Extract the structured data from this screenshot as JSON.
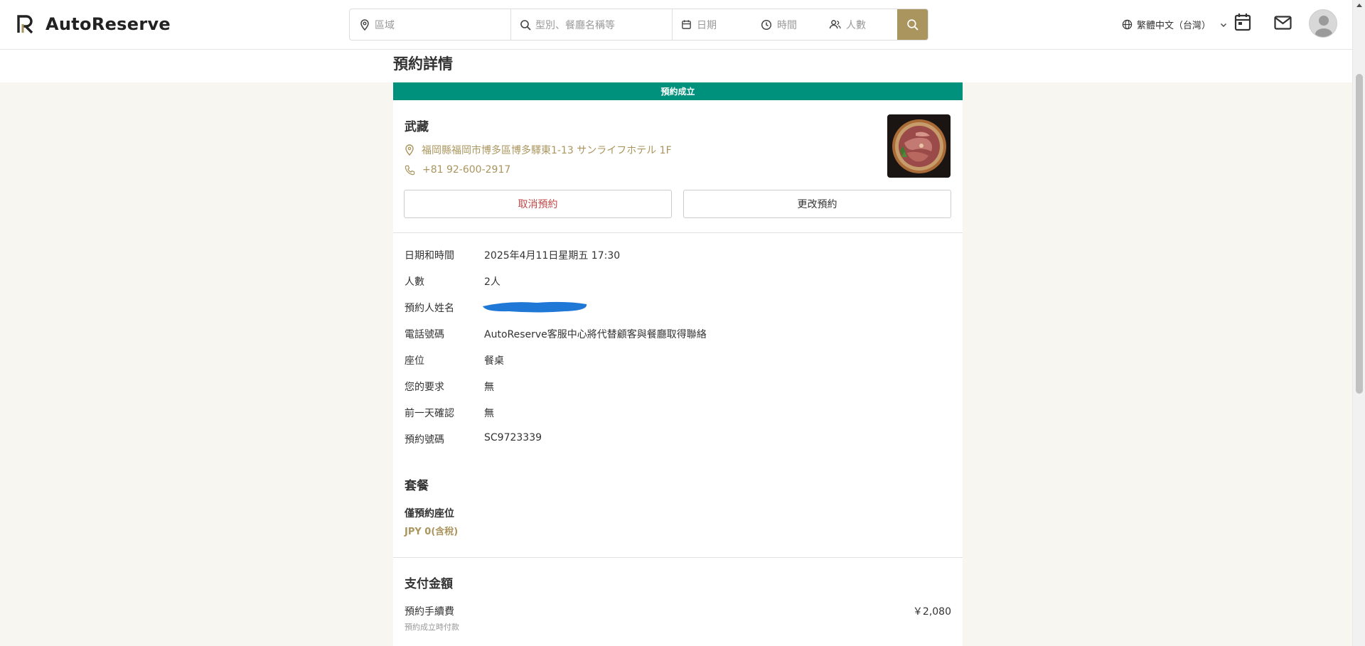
{
  "header": {
    "brand": "AutoReserve",
    "search": {
      "area_placeholder": "區域",
      "genre_placeholder": "型別、餐廳名稱等",
      "date_placeholder": "日期",
      "time_placeholder": "時間",
      "people_placeholder": "人數"
    },
    "language": "繁體中文（台灣）"
  },
  "page": {
    "title": "預約詳情",
    "status": "預約成立"
  },
  "restaurant": {
    "name": "武藏",
    "address": "福岡縣福岡市博多區博多驛東1-13 サンライフホテル 1F",
    "phone": "+81 92-600-2917"
  },
  "actions": {
    "cancel_label": "取消預約",
    "change_label": "更改預約"
  },
  "details": [
    {
      "label": "日期和時間",
      "value": "2025年4月11日星期五 17:30"
    },
    {
      "label": "人數",
      "value": "2人"
    },
    {
      "label": "預約人姓名",
      "value": ""
    },
    {
      "label": "電話號碼",
      "value": "AutoReserve客服中心將代替顧客與餐廳取得聯絡"
    },
    {
      "label": "座位",
      "value": "餐桌"
    },
    {
      "label": "您的要求",
      "value": "無"
    },
    {
      "label": "前一天確認",
      "value": "無"
    },
    {
      "label": "預約號碼",
      "value": "SC9723339"
    }
  ],
  "plan": {
    "section_title": "套餐",
    "name": "僅預約座位",
    "price": "JPY 0(含稅)"
  },
  "payment": {
    "section_title": "支付金額",
    "fee_label": "預約手續費",
    "fee_note": "預約成立時付款",
    "fee_amount": "￥2,080"
  },
  "colors": {
    "accent_gold": "#aa955e",
    "status_green": "#00917c",
    "cancel_red": "#c04848",
    "background_cream": "#f7f6f1",
    "redaction_blue": "#1f77d6"
  }
}
